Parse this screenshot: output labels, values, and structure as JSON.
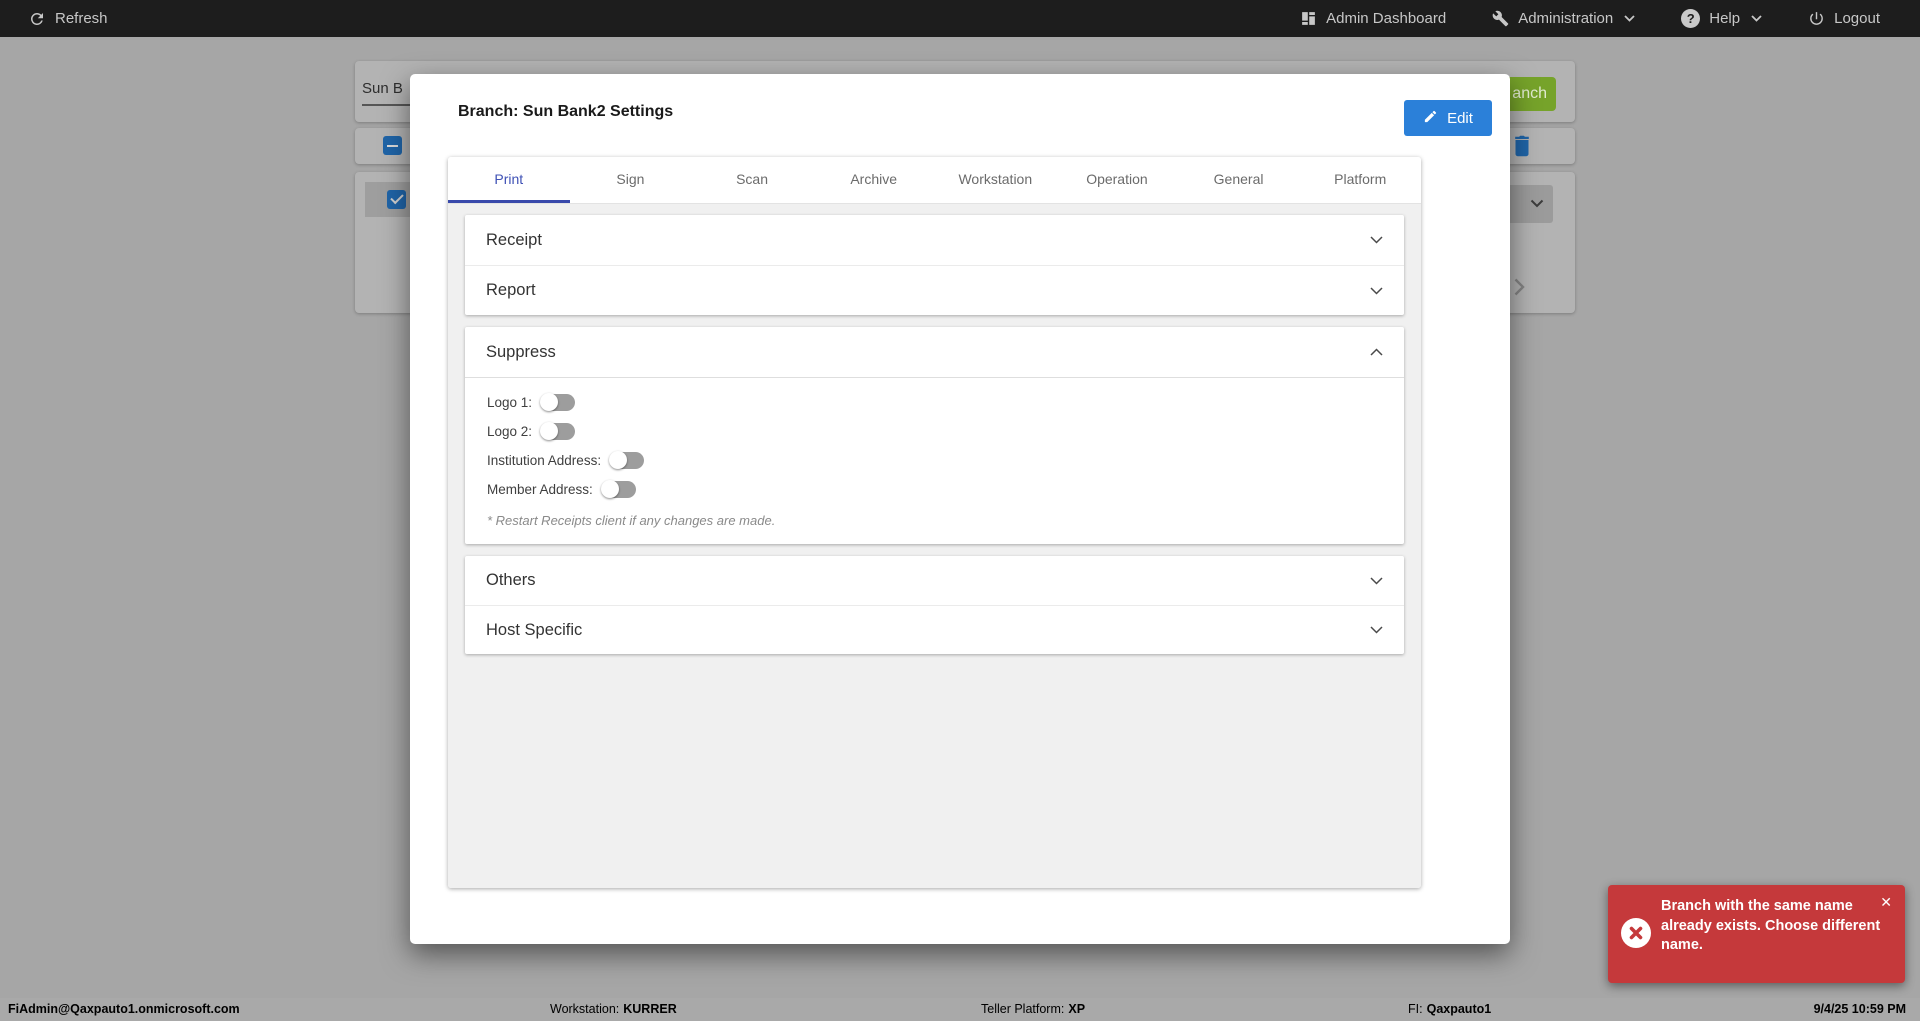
{
  "colors": {
    "topbar-bg": "#1d1d1d",
    "edit-blue": "#2b80d9",
    "tab-indigo": "#3f51b5",
    "tab-underline": "#3949ab",
    "toast-red": "#c5393b",
    "green-dim": "#76a32a",
    "checkbox-blue": "#1f64a7",
    "backdrop": "#a6a6a6"
  },
  "topbar": {
    "refresh_label": "Refresh",
    "admin_dashboard_label": "Admin Dashboard",
    "administration_label": "Administration",
    "help_label": "Help",
    "help_glyph": "?",
    "logout_label": "Logout"
  },
  "backdrop": {
    "branch_name_input_value": "Sun B",
    "add_branch_button_visible_label": "anch"
  },
  "modal": {
    "title": "Branch: Sun Bank2 Settings",
    "edit_button_label": "Edit",
    "active_tab": "Print",
    "tabs": [
      "Print",
      "Sign",
      "Scan",
      "Archive",
      "Workstation",
      "Operation",
      "General",
      "Platform"
    ],
    "accordions": {
      "receipt_label": "Receipt",
      "report_label": "Report",
      "suppress_label": "Suppress",
      "others_label": "Others",
      "host_specific_label": "Host Specific"
    },
    "suppress_section": {
      "toggles": [
        {
          "label": "Logo 1:",
          "state": "off"
        },
        {
          "label": "Logo 2:",
          "state": "off"
        },
        {
          "label": "Institution Address:",
          "state": "off"
        },
        {
          "label": "Member Address:",
          "state": "off"
        }
      ],
      "note": "* Restart Receipts client if any changes are made."
    }
  },
  "toast": {
    "message": "Branch with the same name already exists. Choose different name.",
    "close_glyph": "✕"
  },
  "statusbar": {
    "user": "FiAdmin@Qaxpauto1.onmicrosoft.com",
    "workstation_label": "Workstation:",
    "workstation_value": "KURRER",
    "teller_platform_label": "Teller Platform:",
    "teller_platform_value": "XP",
    "fi_label": "FI:",
    "fi_value": "Qaxpauto1",
    "datetime": "9/4/25 10:59 PM"
  }
}
